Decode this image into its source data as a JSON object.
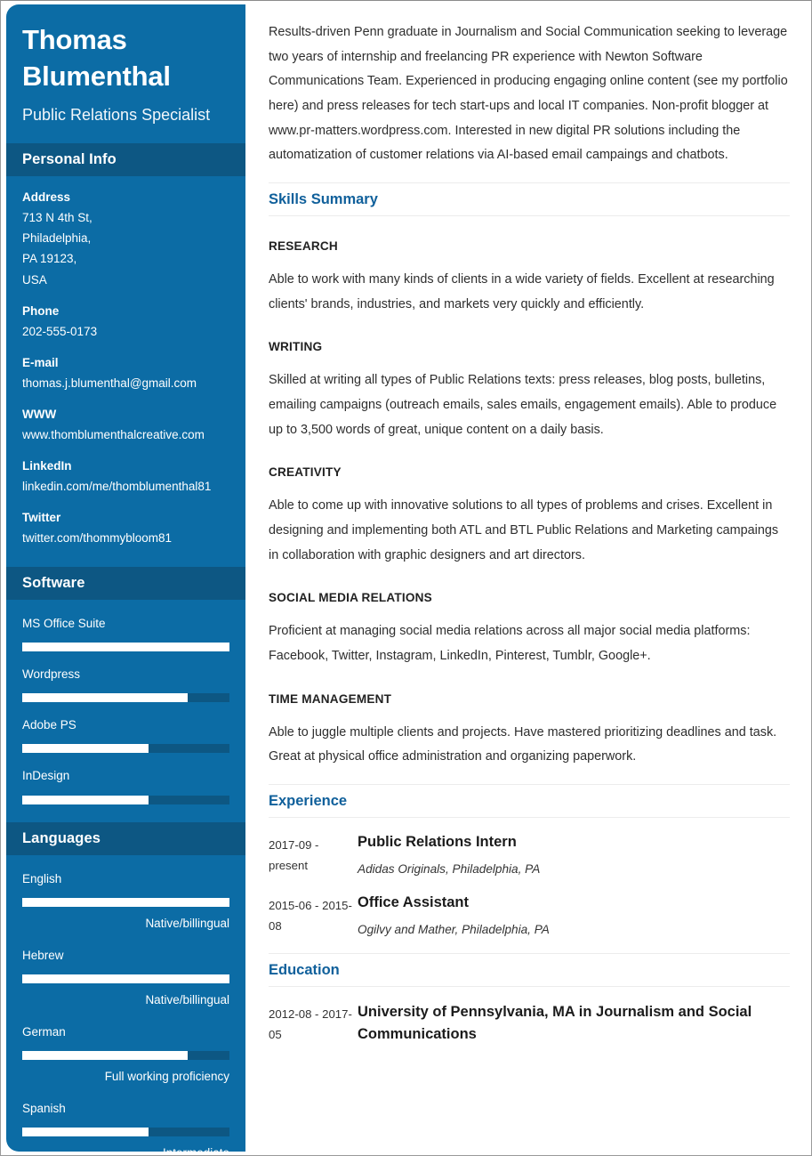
{
  "profile": {
    "full_name": "Thomas Blumenthal",
    "job_title": "Public Relations Specialist"
  },
  "colors": {
    "sidebar_bg": "#0c6ca5",
    "sidebar_header_bg": "#0d5783",
    "accent_heading": "#10609b",
    "bar_fill": "#ffffff",
    "bar_track": "#0d5783"
  },
  "sidebar": {
    "personal_info": {
      "header": "Personal Info",
      "fields": [
        {
          "label": "Address",
          "value": "713 N 4th St,\nPhiladelphia,\nPA 19123,\nUSA"
        },
        {
          "label": "Phone",
          "value": "202-555-0173"
        },
        {
          "label": "E-mail",
          "value": "thomas.j.blumenthal@gmail.com"
        },
        {
          "label": "WWW",
          "value": "www.thomblumenthalcreative.com"
        },
        {
          "label": "LinkedIn",
          "value": "linkedin.com/me/thomblumenthal81"
        },
        {
          "label": "Twitter",
          "value": "twitter.com/thommybloom81"
        }
      ]
    },
    "software": {
      "header": "Software",
      "items": [
        {
          "label": "MS Office Suite",
          "percent": 100
        },
        {
          "label": "Wordpress",
          "percent": 80
        },
        {
          "label": "Adobe PS",
          "percent": 61
        },
        {
          "label": "InDesign",
          "percent": 61
        }
      ]
    },
    "languages": {
      "header": "Languages",
      "items": [
        {
          "label": "English",
          "percent": 100,
          "level": "Native/billingual"
        },
        {
          "label": "Hebrew",
          "percent": 100,
          "level": "Native/billingual"
        },
        {
          "label": "German",
          "percent": 80,
          "level": "Full working proficiency"
        },
        {
          "label": "Spanish",
          "percent": 61,
          "level": "Intermediate"
        }
      ]
    }
  },
  "main": {
    "summary": "Results-driven Penn graduate in Journalism and Social Communication seeking to leverage two years of internship and freelancing PR experience with Newton Software Communications Team. Experienced in producing engaging online content (see my portfolio here) and press releases for tech start-ups and local IT companies. Non-profit blogger at www.pr-matters.wordpress.com. Interested in new digital PR solutions including the automatization of customer relations via AI-based email campaings and chatbots.",
    "skills_summary": {
      "header": "Skills Summary",
      "skills": [
        {
          "name": "RESEARCH",
          "description": "Able to work with many kinds of clients in a wide variety of fields. Excellent at researching clients' brands, industries, and markets very quickly and efficiently."
        },
        {
          "name": "WRITING",
          "description": "Skilled at writing all types of Public Relations texts: press releases, blog posts, bulletins, emailing campaigns (outreach emails, sales emails, engagement emails). Able to produce up to 3,500 words of great, unique content on a daily basis."
        },
        {
          "name": "CREATIVITY",
          "description": "Able to come up with innovative solutions to all types of problems and crises. Excellent in designing and implementing both ATL and BTL Public Relations and Marketing campaings in collaboration with graphic designers and art directors."
        },
        {
          "name": "SOCIAL MEDIA RELATIONS",
          "description": "Proficient at managing social media relations across all major social media platforms: Facebook, Twitter, Instagram, LinkedIn, Pinterest, Tumblr, Google+."
        },
        {
          "name": "TIME MANAGEMENT",
          "description": "Able to juggle multiple clients and projects. Have mastered prioritizing deadlines and task. Great at physical office administration and organizing paperwork."
        }
      ]
    },
    "experience": {
      "header": "Experience",
      "entries": [
        {
          "date": "2017-09 - present",
          "title": "Public Relations Intern",
          "subtitle": "Adidas Originals, Philadelphia, PA"
        },
        {
          "date": "2015-06 - 2015-08",
          "title": "Office Assistant",
          "subtitle": "Ogilvy and Mather, Philadelphia, PA"
        }
      ]
    },
    "education": {
      "header": "Education",
      "entries": [
        {
          "date": "2012-08 - 2017-05",
          "title": "University of Pennsylvania, MA in Journalism and Social Communications",
          "subtitle": ""
        }
      ]
    }
  }
}
